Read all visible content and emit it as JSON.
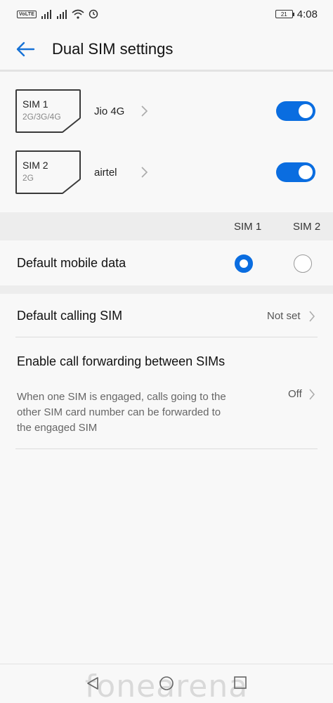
{
  "status_bar": {
    "volte": "VoLTE",
    "battery": "21",
    "time": "4:08"
  },
  "header": {
    "title": "Dual SIM settings"
  },
  "sims": [
    {
      "name": "SIM 1",
      "type": "2G/3G/4G",
      "carrier": "Jio 4G",
      "enabled": true
    },
    {
      "name": "SIM 2",
      "type": "2G",
      "carrier": "airtel",
      "enabled": true
    }
  ],
  "columns": {
    "sim1": "SIM 1",
    "sim2": "SIM 2"
  },
  "default_mobile_data": {
    "label": "Default mobile data",
    "selected": "SIM 1"
  },
  "default_calling": {
    "label": "Default calling SIM",
    "value": "Not set"
  },
  "call_forwarding": {
    "title": "Enable call forwarding between SIMs",
    "description": "When one SIM is engaged, calls going to the other SIM card number can be forwarded to the engaged SIM",
    "value": "Off"
  },
  "watermark": "fonearena",
  "colors": {
    "accent": "#0a6de0"
  }
}
